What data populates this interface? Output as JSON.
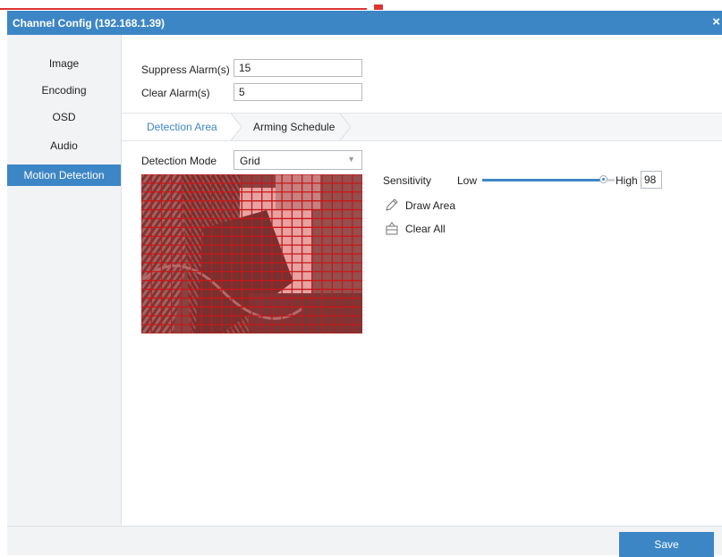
{
  "window": {
    "title": "Channel Config (192.168.1.39)",
    "close_glyph": "×"
  },
  "sidebar": {
    "items": [
      {
        "label": "Image",
        "active": false
      },
      {
        "label": "Encoding",
        "active": false
      },
      {
        "label": "OSD",
        "active": false
      },
      {
        "label": "Audio",
        "active": false
      },
      {
        "label": "Motion Detection",
        "active": true
      }
    ]
  },
  "alarm": {
    "suppress_label": "Suppress Alarm(s)",
    "suppress_value": "15",
    "clear_label": "Clear Alarm(s)",
    "clear_value": "5"
  },
  "tabs": [
    {
      "label": "Detection Area",
      "active": true
    },
    {
      "label": "Arming Schedule",
      "active": false
    }
  ],
  "detection": {
    "mode_label": "Detection Mode",
    "mode_value": "Grid"
  },
  "sensitivity": {
    "label": "Sensitivity",
    "low_label": "Low",
    "high_label": "High",
    "value": "98",
    "level": 0.98
  },
  "tools": {
    "draw_area": "Draw Area",
    "clear_all": "Clear All"
  },
  "footer": {
    "save_label": "Save"
  },
  "colors": {
    "accent": "#3d86c6",
    "grid": "#d42020"
  }
}
